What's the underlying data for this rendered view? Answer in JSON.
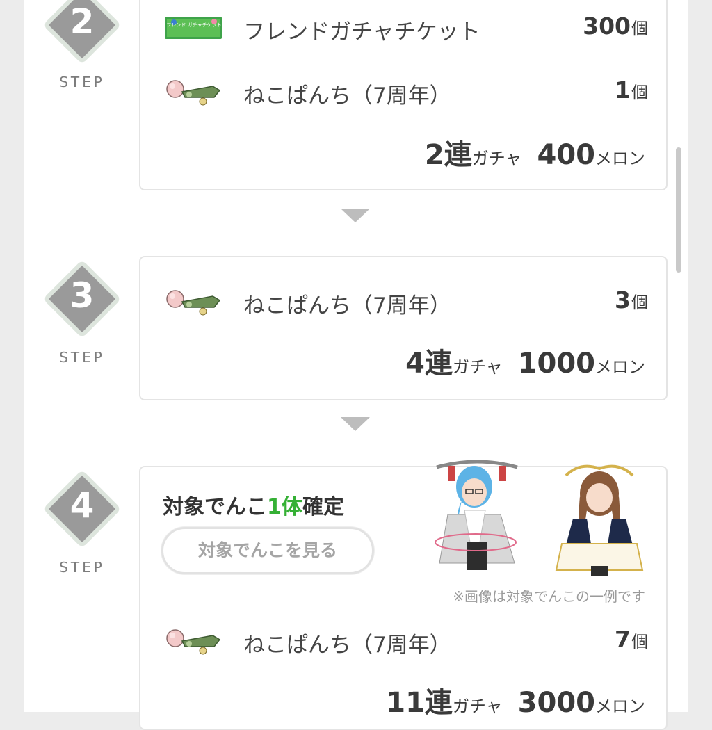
{
  "step_label_text": "STEP",
  "steps": [
    {
      "number": "2",
      "items": [
        {
          "icon": "friend-gacha-ticket-icon",
          "ticket_text": "フレンド ガチャチケット",
          "name": "フレンドガチャチケット",
          "qty": "300",
          "unit": "個"
        },
        {
          "icon": "nekopunch-icon",
          "name": "ねこぱんち（7周年）",
          "qty": "1",
          "unit": "個"
        }
      ],
      "draw_count": "2連",
      "draw_word": "ガチャ",
      "price": "400",
      "currency": "メロン"
    },
    {
      "number": "3",
      "items": [
        {
          "icon": "nekopunch-icon",
          "name": "ねこぱんち（7周年）",
          "qty": "3",
          "unit": "個"
        }
      ],
      "draw_count": "4連",
      "draw_word": "ガチャ",
      "price": "1000",
      "currency": "メロン"
    },
    {
      "number": "4",
      "guarantee": {
        "prefix": "対象でんこ",
        "highlight": "1体",
        "suffix": "確定"
      },
      "view_button": "対象でんこを見る",
      "image_note": "※画像は対象でんこの一例です",
      "items": [
        {
          "icon": "nekopunch-icon",
          "name": "ねこぱんち（7周年）",
          "qty": "7",
          "unit": "個"
        }
      ],
      "draw_count": "11連",
      "draw_word": "ガチャ",
      "price": "3000",
      "currency": "メロン"
    }
  ],
  "colors": {
    "highlight": "#35b035",
    "badge": "#9a9a9a",
    "panel": "#ffffff",
    "background": "#ececec"
  }
}
